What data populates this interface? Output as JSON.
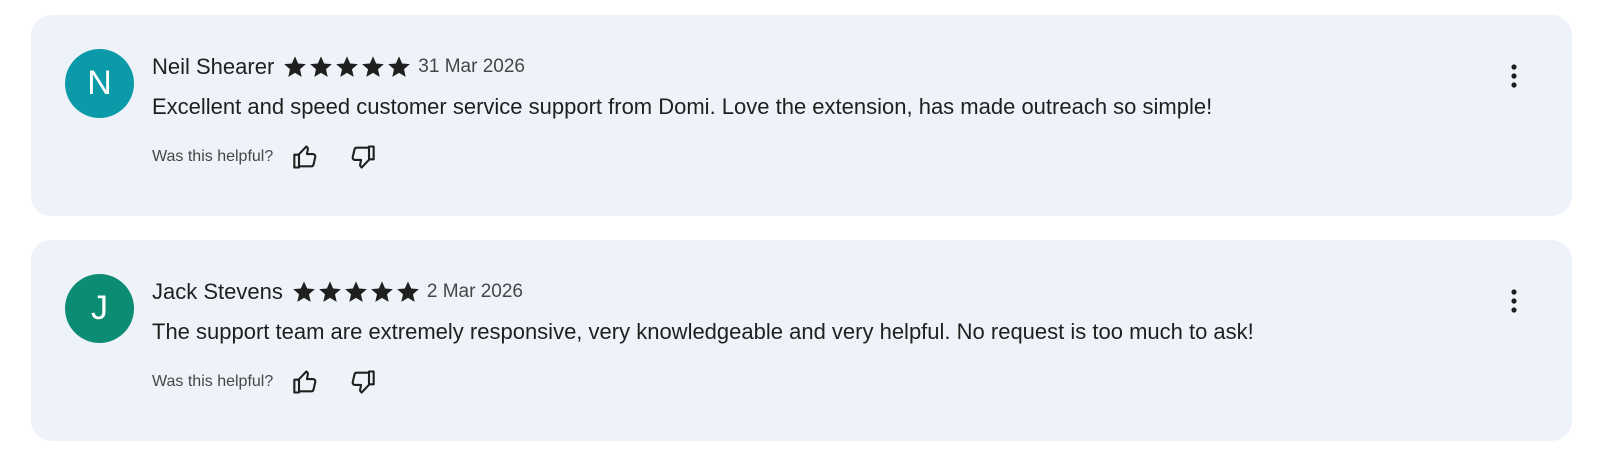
{
  "reviews": [
    {
      "initial": "N",
      "avatar_color": "#0b9aa8",
      "name": "Neil Shearer",
      "rating": 5,
      "date": "31 Mar 2026",
      "text": "Excellent and speed customer service support from Domi. Love the extension, has made outreach so simple!",
      "helpful_label": "Was this helpful?",
      "icons": {
        "thumb_up": "thumbs-up-icon",
        "thumb_down": "thumbs-down-icon",
        "more": "more-vert-icon"
      }
    },
    {
      "initial": "J",
      "avatar_color": "#0b8c73",
      "name": "Jack Stevens",
      "rating": 5,
      "date": "2 Mar 2026",
      "text": "The support team are extremely responsive, very knowledgeable and very helpful. No request is too much to ask!",
      "helpful_label": "Was this helpful?",
      "icons": {
        "thumb_up": "thumbs-up-icon",
        "thumb_down": "thumbs-down-icon",
        "more": "more-vert-icon"
      }
    }
  ],
  "colors": {
    "card_background": "#eef3fa",
    "star": "#1f1f1f",
    "text_primary": "#1f1f1f",
    "text_secondary": "#444746"
  }
}
